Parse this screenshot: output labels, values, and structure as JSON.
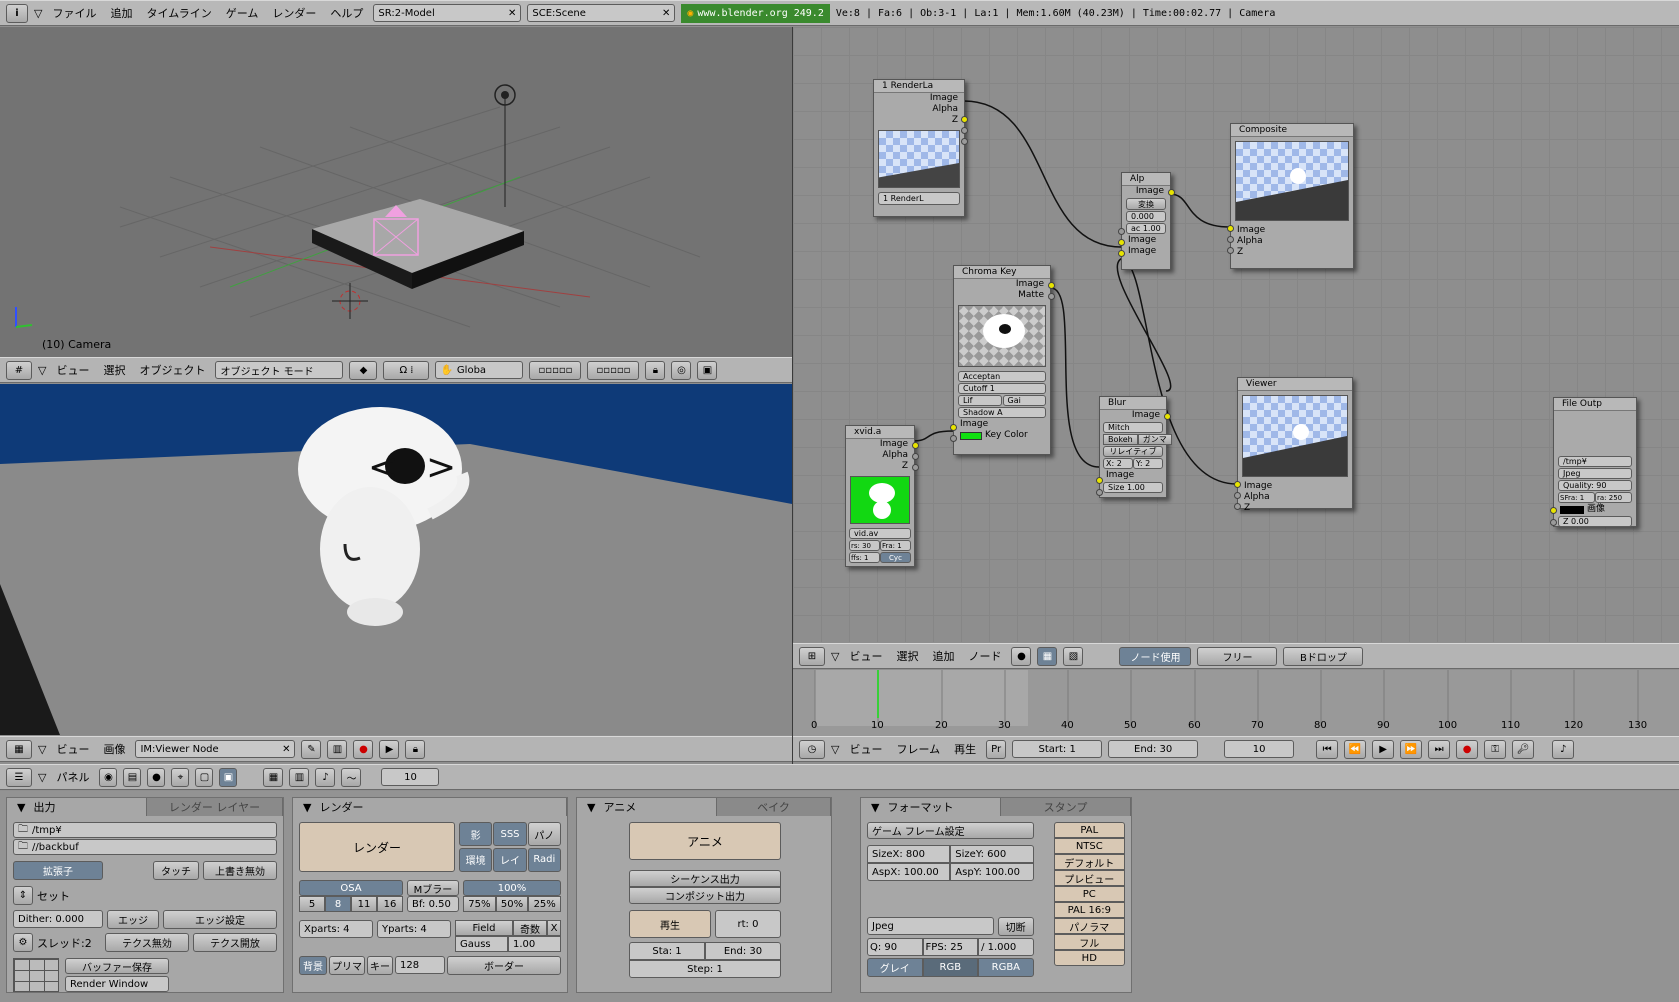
{
  "topbar": {
    "menus": [
      "ファイル",
      "追加",
      "タイムライン",
      "ゲーム",
      "レンダー",
      "ヘルプ"
    ],
    "screen": "SR:2-Model",
    "scene": "SCE:Scene",
    "url": "www.blender.org 249.2",
    "stats": "Ve:8 | Fa:6 | Ob:3-1 | La:1  | Mem:1.60M (40.23M)  | Time:00:02.77 | Camera"
  },
  "viewport3d": {
    "overlay_label": "(10) Camera",
    "menus": [
      "ビュー",
      "選択",
      "オブジェクト"
    ],
    "mode": "オブジェクト モード",
    "orientation": "Globa"
  },
  "image_editor": {
    "menus": [
      "ビュー",
      "画像"
    ],
    "image_name": "IM:Viewer Node"
  },
  "node_editor": {
    "menus": [
      "ビュー",
      "選択",
      "追加",
      "ノード"
    ],
    "use_nodes": "ノード使用",
    "free": "フリー",
    "backdrop": "Bドロップ",
    "nodes": {
      "render_layers": {
        "title": "1 RenderLa",
        "outputs": [
          "Image",
          "Alpha",
          "Z"
        ],
        "layer": "1 RenderL"
      },
      "alpha_over": {
        "title": "Alp",
        "convert": "変換",
        "value": "0.000",
        "fac": "ac 1.00",
        "inputs": [
          "Image",
          "Image"
        ],
        "output": "Image"
      },
      "composite": {
        "title": "Composite",
        "inputs": [
          "Image",
          "Alpha",
          "Z"
        ]
      },
      "chroma_key": {
        "title": "Chroma Key",
        "outputs": [
          "Image",
          "Matte"
        ],
        "fields": [
          "Acceptan",
          "Cutoff 1",
          "Lif",
          "Gai",
          "Shadow A"
        ],
        "inputs": [
          "Image",
          "Key Color"
        ]
      },
      "blur": {
        "title": "Blur",
        "output": "Image",
        "filter": "Mitch",
        "bokeh": "Bokeh",
        "gamma": "ガンマ",
        "relative": "リレイティブ",
        "xy": "X: 2",
        "y": "Y: 2",
        "input": "Image",
        "size": "Size 1.00"
      },
      "viewer": {
        "title": "Viewer",
        "inputs": [
          "Image",
          "Alpha",
          "Z"
        ]
      },
      "movie": {
        "title": "xvid.a",
        "outputs": [
          "Image",
          "Alpha",
          "Z"
        ],
        "file": "vid.av",
        "frs": "rs: 30",
        "fra": "Fra: 1",
        "offs": "ffs: 1",
        "cyc": "Cyc"
      },
      "file_output": {
        "title": "File Outp",
        "path": "/tmp¥",
        "format": "Jpeg",
        "quality": "Quality: 90",
        "sfra": "SFra: 1",
        "efra": "ra: 250",
        "image_label": "画像",
        "z": "Z 0.00"
      }
    }
  },
  "timeline": {
    "ticks": [
      "0",
      "10",
      "20",
      "30",
      "40",
      "50",
      "60",
      "70",
      "80",
      "90",
      "100",
      "110",
      "120",
      "130"
    ],
    "menus": [
      "ビュー",
      "フレーム",
      "再生"
    ],
    "pr": "Pr",
    "start": "Start: 1",
    "end": "End: 30",
    "current": "10"
  },
  "buttons_header": {
    "panel_label": "パネル",
    "frame": "10"
  },
  "output_panel": {
    "tab_active": "出力",
    "tab2": "レンダー レイヤー",
    "path1": "/tmp¥",
    "path2": "//backbuf",
    "ext": "拡張子",
    "touch": "タッチ",
    "no_overwrite": "上書き無効",
    "set": "セット",
    "dither": "Dither: 0.000",
    "edge": "エッジ",
    "edge_settings": "エッジ設定",
    "threads": "スレッド:2",
    "tex_free": "テクス無効",
    "tex_open": "テクス開放",
    "save_buffers": "バッファー保存",
    "render_window": "Render Window"
  },
  "render_panel": {
    "title": "レンダー",
    "render": "レンダー",
    "shadow": "影",
    "sss": "SSS",
    "pano": "パノ",
    "env": "環境",
    "ray": "レイ",
    "radio": "Radi",
    "osa": "OSA",
    "mblur": "Mブラー",
    "pct": "100%",
    "osa_vals": [
      "5",
      "8",
      "11",
      "16"
    ],
    "bf": "Bf: 0.50",
    "pcts": [
      "75%",
      "50%",
      "25%"
    ],
    "xparts": "Xparts: 4",
    "yparts": "Yparts: 4",
    "field": "Field",
    "odd": "奇数",
    "x": "X",
    "gauss": "Gauss",
    "gauss_val": "1.00",
    "sky": "背景",
    "premul": "プリマ",
    "key": "キー",
    "size": "128",
    "border": "ボーダー"
  },
  "anim_panel": {
    "tab_active": "アニメ",
    "tab2": "ベイク",
    "anim": "アニメ",
    "seq": "シーケンス出力",
    "comp": "コンポジット出力",
    "play": "再生",
    "rt": "rt: 0",
    "sta": "Sta: 1",
    "end": "End: 30",
    "step": "Step: 1"
  },
  "format_panel": {
    "tab_active": "フォーマット",
    "tab2": "スタンプ",
    "game_frame": "ゲーム フレーム設定",
    "sizex": "SizeX: 800",
    "sizey": "SizeY: 600",
    "aspx": "AspX: 100.00",
    "aspy": "AspY: 100.00",
    "format": "Jpeg",
    "crop": "切断",
    "quality": "Q: 90",
    "fps": "FPS: 25",
    "fps_base": "/ 1.000",
    "grey": "グレイ",
    "rgb": "RGB",
    "rgba": "RGBA",
    "presets": [
      "PAL",
      "NTSC",
      "デフォルト",
      "プレビュー",
      "PC",
      "PAL 16:9",
      "パノラマ",
      "フル",
      "HD"
    ]
  }
}
